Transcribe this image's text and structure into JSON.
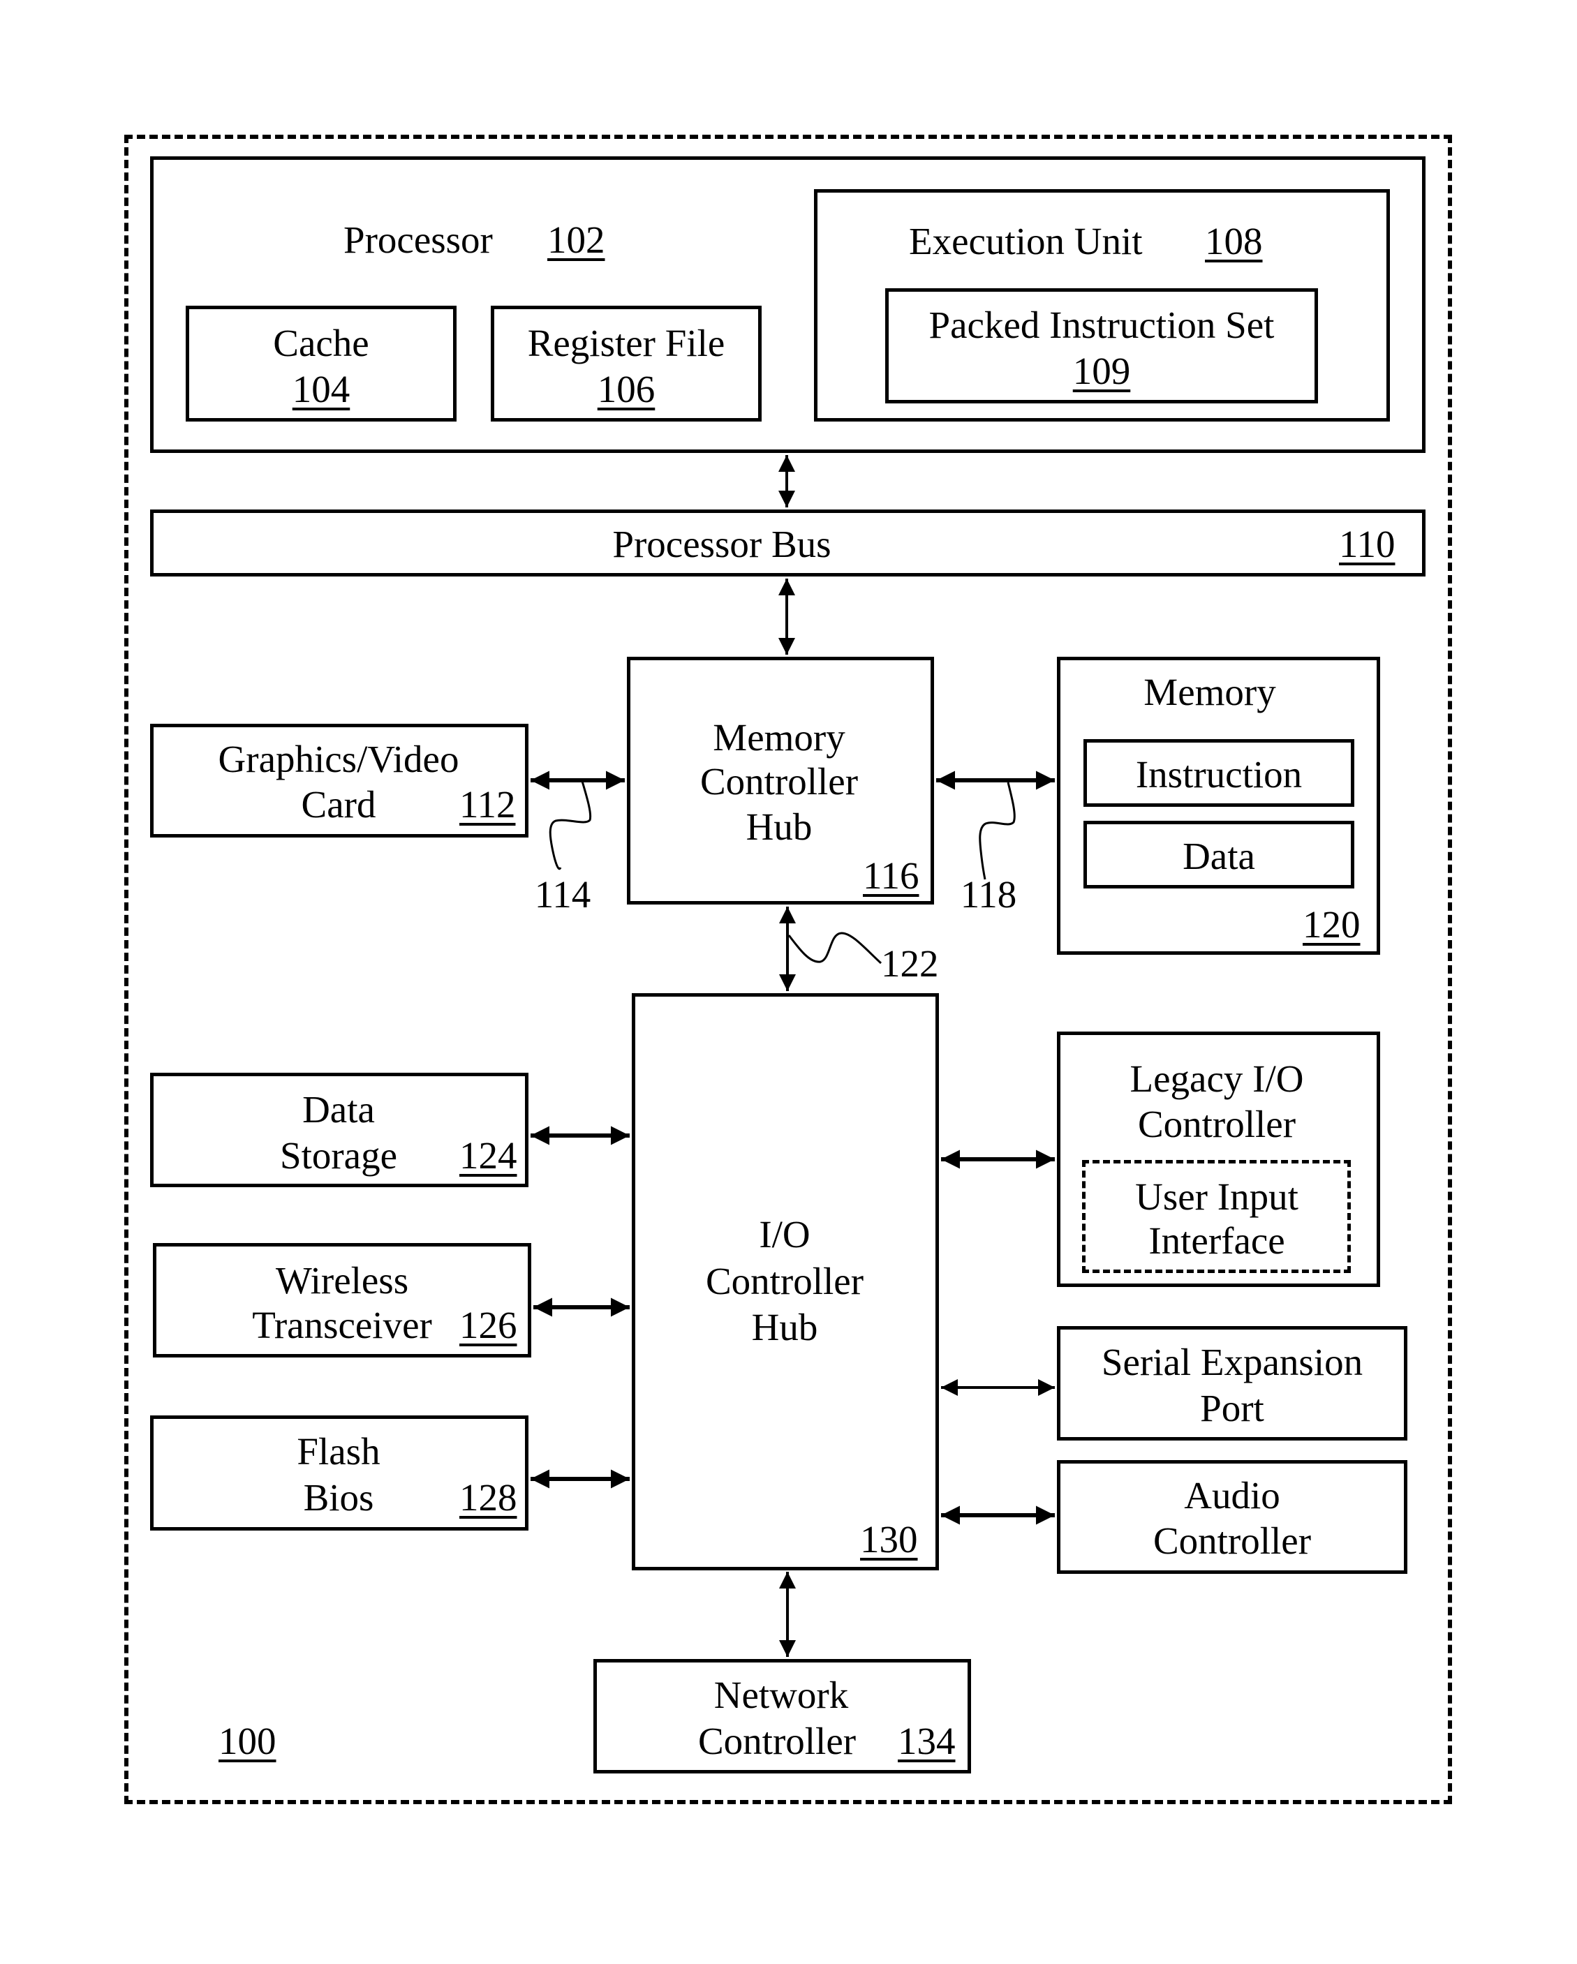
{
  "figure": {
    "system_ref": "100",
    "processor": {
      "label": "Processor",
      "ref": "102"
    },
    "cache": {
      "label": "Cache",
      "ref": "104"
    },
    "register_file": {
      "label": "Register File",
      "ref": "106"
    },
    "execution_unit": {
      "label": "Execution Unit",
      "ref": "108"
    },
    "packed_instruction_set": {
      "label": "Packed Instruction Set",
      "ref": "109"
    },
    "processor_bus": {
      "label": "Processor Bus",
      "ref": "110"
    },
    "graphics_card": {
      "label_line1": "Graphics/Video",
      "label_line2": "Card",
      "ref": "112"
    },
    "graphics_link_ref": "114",
    "memory_controller_hub": {
      "line1": "Memory",
      "line2": "Controller",
      "line3": "Hub",
      "ref": "116"
    },
    "memory_link_ref": "118",
    "memory": {
      "label": "Memory",
      "instruction": "Instruction",
      "data": "Data",
      "ref": "120"
    },
    "hub_link_ref": "122",
    "data_storage": {
      "line1": "Data",
      "line2": "Storage",
      "ref": "124"
    },
    "wireless_transceiver": {
      "line1": "Wireless",
      "line2": "Transceiver",
      "ref": "126"
    },
    "flash_bios": {
      "line1": "Flash",
      "line2": "Bios",
      "ref": "128"
    },
    "io_controller_hub": {
      "line1": "I/O",
      "line2": "Controller",
      "line3": "Hub",
      "ref": "130"
    },
    "legacy_io_controller": {
      "line1": "Legacy I/O",
      "line2": "Controller"
    },
    "user_input_interface": {
      "line1": "User Input",
      "line2": "Interface"
    },
    "serial_expansion_port": {
      "line1": "Serial Expansion",
      "line2": "Port"
    },
    "audio_controller": {
      "line1": "Audio",
      "line2": "Controller"
    },
    "network_controller": {
      "line1": "Network",
      "line2": "Controller",
      "ref": "134"
    }
  }
}
